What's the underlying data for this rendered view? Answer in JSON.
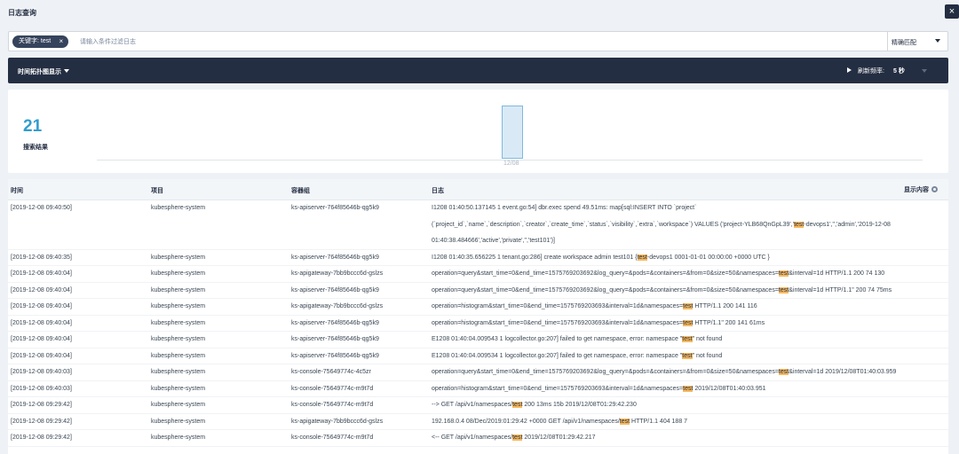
{
  "window": {
    "title": "日志查询",
    "close_glyph": "×"
  },
  "search": {
    "chip_label": "关键字: test",
    "chip_close": "×",
    "placeholder": "请输入条件过滤日志",
    "match_mode": "精确匹配"
  },
  "toolbar": {
    "histogram_toggle": "时间拓扑图显示",
    "refresh_label": "刷新频率:",
    "refresh_value": "5 秒"
  },
  "histogram": {
    "total_count": "21",
    "total_label": "搜索结果",
    "tick_label": "12/08"
  },
  "table": {
    "columns": [
      "时间",
      "项目",
      "容器组",
      "日志"
    ],
    "display_content_label": "显示内容",
    "rows": [
      {
        "time": "[2019-12-08 09:40:50]",
        "project": "kubesphere-system",
        "pod": "ks-apiserver-764f85646b-qg5k9",
        "log": [
          [
            "I1208 01:40:50.137145 1 event.go:54] dbr.exec spend 49.51ms: map[sql:INSERT INTO `project`"
          ],
          [
            "(`project_id`,`name`,`description`,`creator`,`create_time`,`status`,`visibility`,`extra`,`workspace`) VALUES ('project-YLB68QnGpL39','",
            {
              "hl": "test"
            },
            "-devops1','','admin','2019-12-08"
          ],
          [
            "01:40:38.484666','active','private','','test101')]"
          ]
        ]
      },
      {
        "time": "[2019-12-08 09:40:35]",
        "project": "kubesphere-system",
        "pod": "ks-apiserver-764f85646b-qg5k9",
        "log": [
          [
            "I1208 01:40:35.656225 1 tenant.go:286] create workspace admin test101 {",
            {
              "hl": "test"
            },
            "-devops1 0001-01-01 00:00:00 +0000 UTC }"
          ]
        ]
      },
      {
        "time": "[2019-12-08 09:40:04]",
        "project": "kubesphere-system",
        "pod": "ks-apigateway-7bb9bccc6d-gslzs",
        "log": [
          [
            "operation=query&start_time=0&end_time=1575769203692&log_query=&pods=&containers=&from=0&size=50&namespaces=",
            {
              "hl": "test"
            },
            "&interval=1d HTTP/1.1 200 74 130"
          ]
        ]
      },
      {
        "time": "[2019-12-08 09:40:04]",
        "project": "kubesphere-system",
        "pod": "ks-apiserver-764f85646b-qg5k9",
        "log": [
          [
            "operation=query&start_time=0&end_time=1575769203692&log_query=&pods=&containers=&from=0&size=50&namespaces=",
            {
              "hl": "test"
            },
            "&interval=1d HTTP/1.1\" 200 74 75ms"
          ]
        ]
      },
      {
        "time": "[2019-12-08 09:40:04]",
        "project": "kubesphere-system",
        "pod": "ks-apigateway-7bb9bccc6d-gslzs",
        "log": [
          [
            "operation=histogram&start_time=0&end_time=1575769203693&interval=1d&namespaces=",
            {
              "hl": "test"
            },
            " HTTP/1.1 200 141 116"
          ]
        ]
      },
      {
        "time": "[2019-12-08 09:40:04]",
        "project": "kubesphere-system",
        "pod": "ks-apiserver-764f85646b-qg5k9",
        "log": [
          [
            "operation=histogram&start_time=0&end_time=1575769203693&interval=1d&namespaces=",
            {
              "hl": "test"
            },
            " HTTP/1.1\" 200 141 61ms"
          ]
        ]
      },
      {
        "time": "[2019-12-08 09:40:04]",
        "project": "kubesphere-system",
        "pod": "ks-apiserver-764f85646b-qg5k9",
        "log": [
          [
            "E1208 01:40:04.009543 1 logcollector.go:207] failed to get namespace, error: namespace \"",
            {
              "hl": "test"
            },
            "\" not found"
          ]
        ]
      },
      {
        "time": "[2019-12-08 09:40:04]",
        "project": "kubesphere-system",
        "pod": "ks-apiserver-764f85646b-qg5k9",
        "log": [
          [
            "E1208 01:40:04.009534 1 logcollector.go:207] failed to get namespace, error: namespace \"",
            {
              "hl": "test"
            },
            "\" not found"
          ]
        ]
      },
      {
        "time": "[2019-12-08 09:40:03]",
        "project": "kubesphere-system",
        "pod": "ks-console-75649774c-4c5zr",
        "log": [
          [
            "operation=query&start_time=0&end_time=1575769203692&log_query=&pods=&containers=&from=0&size=50&namespaces=",
            {
              "hl": "test"
            },
            "&interval=1d 2019/12/08T01:40:03.959"
          ]
        ]
      },
      {
        "time": "[2019-12-08 09:40:03]",
        "project": "kubesphere-system",
        "pod": "ks-console-75649774c-m9t7d",
        "log": [
          [
            "operation=histogram&start_time=0&end_time=1575769203693&interval=1d&namespaces=",
            {
              "hl": "test"
            },
            " 2019/12/08T01:40:03.951"
          ]
        ]
      },
      {
        "time": "[2019-12-08 09:29:42]",
        "project": "kubesphere-system",
        "pod": "ks-console-75649774c-m9t7d",
        "log": [
          [
            "--> GET /api/v1/namespaces/",
            {
              "hl": "test"
            },
            " 200 13ms 15b 2019/12/08T01:29:42.230"
          ]
        ]
      },
      {
        "time": "[2019-12-08 09:29:42]",
        "project": "kubesphere-system",
        "pod": "ks-apigateway-7bb9bccc6d-gslzs",
        "log": [
          [
            "192.168.0.4 08/Dec/2019:01:29:42 +0000 GET /api/v1/namespaces/",
            {
              "hl": "test"
            },
            " HTTP/1.1 404 188 7"
          ]
        ]
      },
      {
        "time": "[2019-12-08 09:29:42]",
        "project": "kubesphere-system",
        "pod": "ks-console-75649774c-m9t7d",
        "log": [
          [
            "<-- GET /api/v1/namespaces/",
            {
              "hl": "test"
            },
            " 2019/12/08T01:29:42.217"
          ]
        ]
      }
    ]
  },
  "colors": {
    "highlight": "#f7b95e",
    "toolbar_bg": "#242e42",
    "accent_count": "#329dce"
  }
}
